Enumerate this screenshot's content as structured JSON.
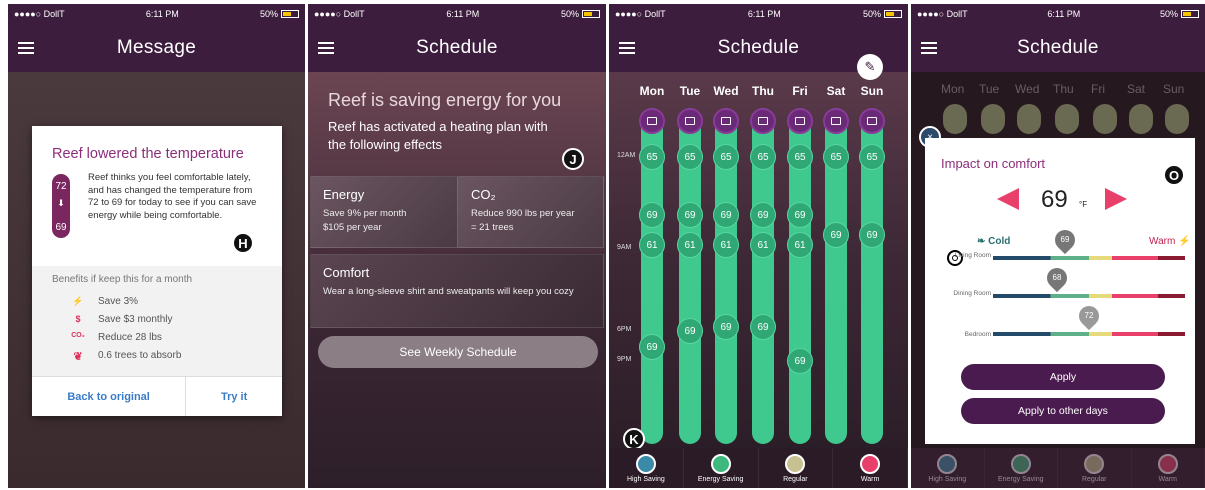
{
  "status": {
    "carrier": "●●●●○ DollT",
    "time": "6:11 PM",
    "battery": "50%"
  },
  "screen1": {
    "title": "Message",
    "card_title": "Reef lowered the temperature",
    "temp_from": "72",
    "temp_to": "69",
    "message": "Reef thinks you feel comfortable lately, and has changed the temperature from 72 to 69 for today to see if you can save energy while being comfortable.",
    "badge": "H",
    "benefits_title": "Benefits if keep this for a month",
    "benefits": [
      {
        "icon": "⚡",
        "text": "Save 3%"
      },
      {
        "icon": "$",
        "text": "Save $3 monthly"
      },
      {
        "icon": "CO₂",
        "text": "Reduce 28 lbs"
      },
      {
        "icon": "❦",
        "text": "0.6 trees to absorb"
      }
    ],
    "back_label": "Back to original",
    "try_label": "Try it"
  },
  "screen2": {
    "title": "Schedule",
    "heading": "Reef is saving energy for you",
    "sub": "Reef has activated a heating plan with the following effects",
    "badge": "J",
    "energy": {
      "title": "Energy",
      "line1": "Save 9% per month",
      "line2": "$105 per year"
    },
    "co2": {
      "title": "CO₂",
      "line1": "Reduce 990 lbs per year",
      "line2": "= 21 trees"
    },
    "comfort": {
      "title": "Comfort",
      "text": "Wear a long-sleeve shirt and sweatpants will keep you cozy"
    },
    "button": "See Weekly Schedule"
  },
  "screen3": {
    "title": "Schedule",
    "days": [
      "Mon",
      "Tue",
      "Wed",
      "Thu",
      "Fri",
      "Sat",
      "Sun"
    ],
    "time_labels": [
      "12AM",
      "9AM",
      "6PM",
      "9PM"
    ],
    "nodes": [
      [
        "65",
        "69",
        "61",
        "69"
      ],
      [
        "65",
        "69",
        "61",
        "69"
      ],
      [
        "65",
        "69",
        "61",
        "69"
      ],
      [
        "65",
        "69",
        "61",
        "69"
      ],
      [
        "65",
        "69",
        "61",
        "69"
      ],
      [
        "65",
        "69"
      ],
      [
        "65",
        "69"
      ]
    ],
    "badge": "K",
    "modes": [
      "High Saving",
      "Energy Saving",
      "Regular",
      "Warm"
    ]
  },
  "screen4": {
    "title": "Schedule",
    "days": [
      "Mon",
      "Tue",
      "Wed",
      "Thu",
      "Fri",
      "Sat",
      "Sun"
    ],
    "modal_title": "Impact on comfort",
    "badge": "O",
    "close": "×",
    "temp": "69",
    "unit": "°F",
    "cold": "Cold",
    "warm": "Warm",
    "rooms": [
      {
        "name": "Living Room",
        "value": "69"
      },
      {
        "name": "Dining Room",
        "value": "68"
      },
      {
        "name": "Bedroom",
        "value": "72"
      }
    ],
    "apply": "Apply",
    "apply_other": "Apply to other days",
    "modes": [
      "High Saving",
      "Energy Saving",
      "Regular",
      "Warm"
    ]
  },
  "colors": {
    "purple": "#3d1d3e",
    "green": "#3fc98e",
    "accent": "#e8406a",
    "title": "#8b2e7a"
  }
}
